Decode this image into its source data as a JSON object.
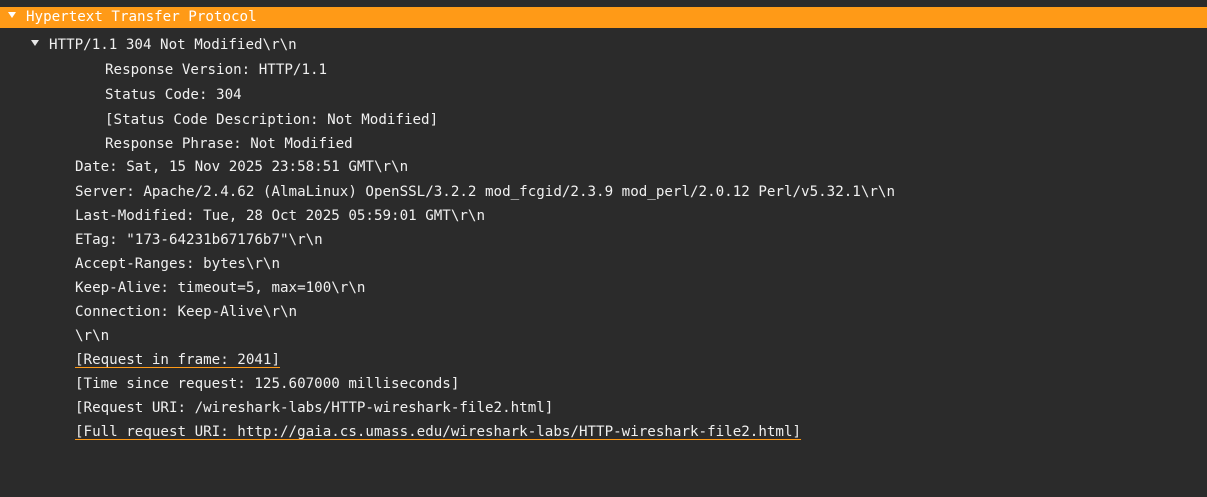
{
  "tree": {
    "root": "Hypertext Transfer Protocol",
    "status_line": {
      "label": "HTTP/1.1 304 Not Modified\\r\\n",
      "children": [
        "Response Version: HTTP/1.1",
        "Status Code: 304",
        "[Status Code Description: Not Modified]",
        "Response Phrase: Not Modified"
      ]
    },
    "headers": [
      "Date: Sat, 15 Nov 2025 23:58:51 GMT\\r\\n",
      "Server: Apache/2.4.62 (AlmaLinux) OpenSSL/3.2.2 mod_fcgid/2.3.9 mod_perl/2.0.12 Perl/v5.32.1\\r\\n",
      "Last-Modified: Tue, 28 Oct 2025 05:59:01 GMT\\r\\n",
      "ETag: \"173-64231b67176b7\"\\r\\n",
      "Accept-Ranges: bytes\\r\\n",
      "Keep-Alive: timeout=5, max=100\\r\\n",
      "Connection: Keep-Alive\\r\\n",
      "\\r\\n"
    ],
    "request_in_frame": "[Request in frame: 2041]",
    "time_since_request": "[Time since request: 125.607000 milliseconds]",
    "request_uri": "[Request URI: /wireshark-labs/HTTP-wireshark-file2.html]",
    "full_request_uri": "[Full request URI: http://gaia.cs.umass.edu/wireshark-labs/HTTP-wireshark-file2.html]"
  },
  "colors": {
    "background": "#2b2b2b",
    "selection": "#ff9a17",
    "text": "#f0f0f0",
    "link_underline": "#ff9a17"
  }
}
